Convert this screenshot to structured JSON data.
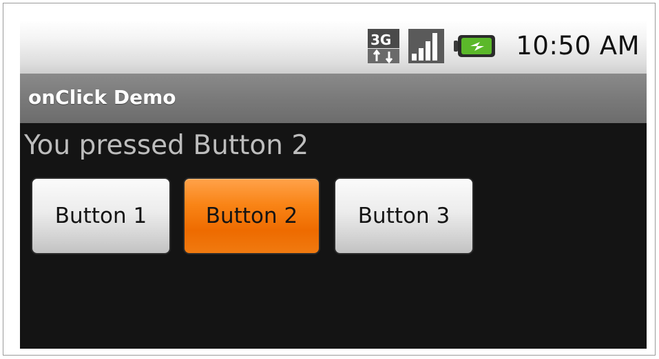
{
  "status_bar": {
    "network_label": "3G",
    "network_icon": "3g-data-icon",
    "signal_icon": "signal-strength-icon",
    "battery_icon": "battery-charging-icon",
    "time": "10:50 AM"
  },
  "app": {
    "title": "onClick Demo"
  },
  "content": {
    "result_text": "You pressed Button 2"
  },
  "buttons": [
    {
      "label": "Button 1",
      "state": "normal"
    },
    {
      "label": "Button 2",
      "state": "pressed"
    },
    {
      "label": "Button 3",
      "state": "normal"
    }
  ],
  "colors": {
    "pressed_button": "#f57f12",
    "screen_background": "#141414",
    "title_bar": "#7a7a7a"
  }
}
